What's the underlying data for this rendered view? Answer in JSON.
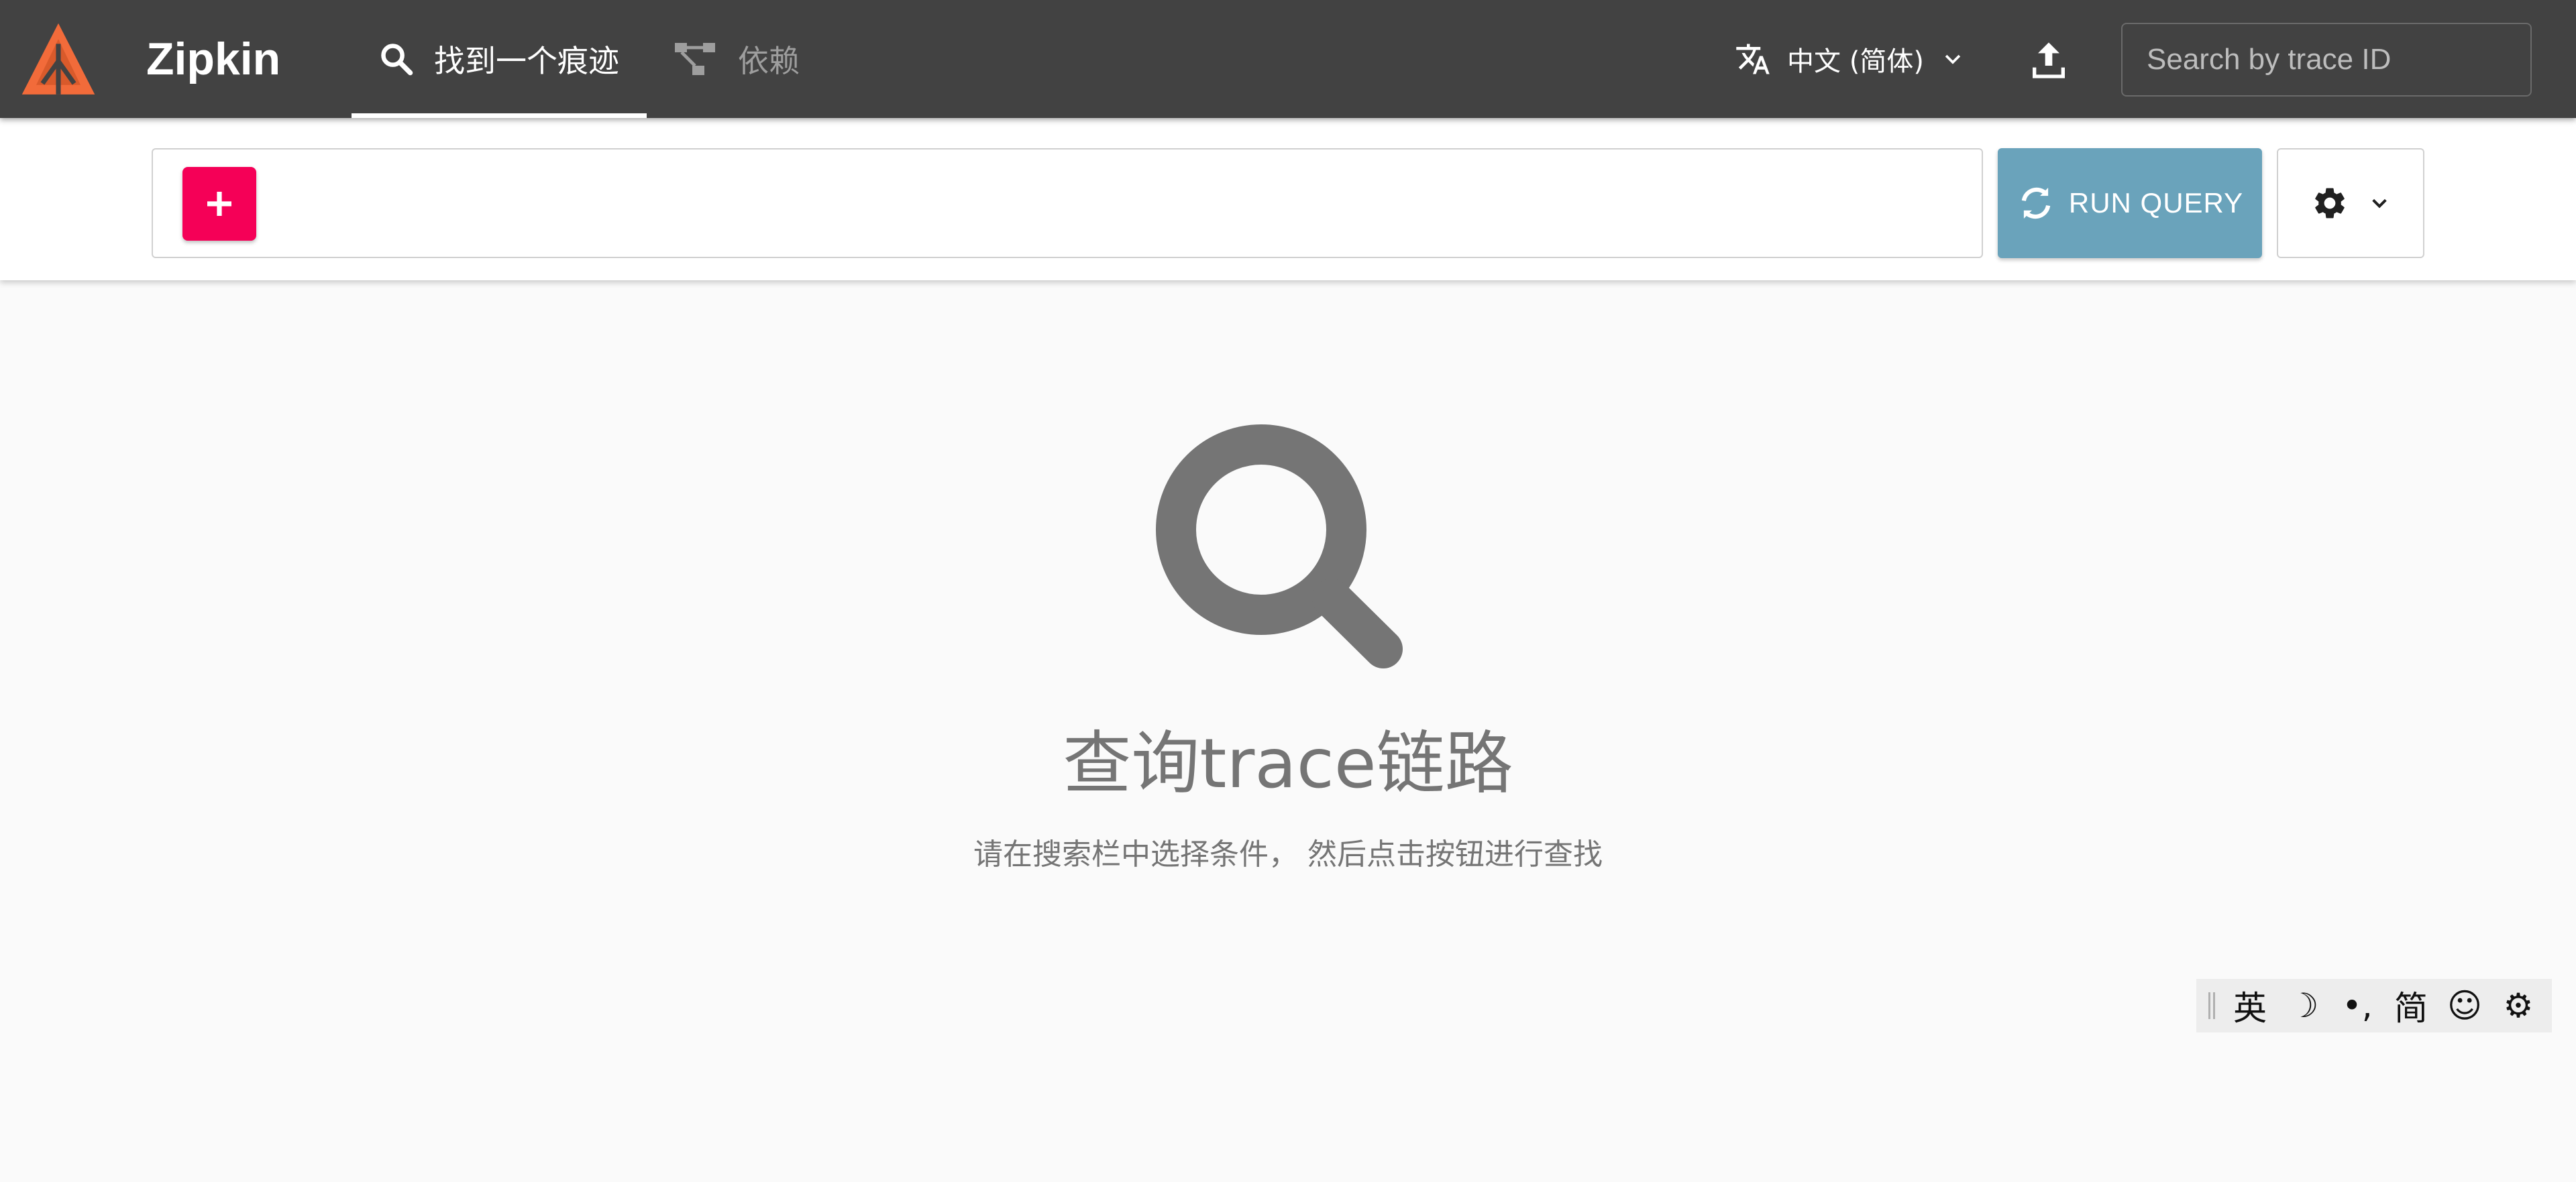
{
  "header": {
    "app_name": "Zipkin",
    "brand_color": "#f26b3a",
    "bar_color": "#424242",
    "tabs": [
      {
        "label": "找到一个痕迹",
        "icon": "search-icon",
        "active": true
      },
      {
        "label": "依赖",
        "icon": "dependency-graph-icon",
        "active": false
      }
    ],
    "language": {
      "icon": "translate-icon",
      "label": "中文 (简体)"
    },
    "upload_icon": "upload-icon",
    "trace_search": {
      "placeholder": "Search by trace ID",
      "value": ""
    }
  },
  "query_bar": {
    "add_icon": "plus-icon",
    "add_color": "#f50057",
    "run_button": {
      "label": "RUN QUERY",
      "icon": "refresh-icon",
      "color": "#6aa3bb"
    },
    "settings_icon": "gear-icon"
  },
  "empty_state": {
    "icon": "search-icon",
    "title": "查询trace链路",
    "description": "请在搜索栏中选择条件， 然后点击按钮进行查找"
  },
  "ime_toolbar": {
    "items": [
      {
        "name": "ime-mode-english",
        "label": "英"
      },
      {
        "name": "ime-moon-icon",
        "label": "☽"
      },
      {
        "name": "ime-punctuation",
        "label": "•,"
      },
      {
        "name": "ime-simplified",
        "label": "简"
      },
      {
        "name": "ime-emoji-icon",
        "label": "☺"
      },
      {
        "name": "ime-gear-icon",
        "label": "⚙"
      }
    ]
  }
}
